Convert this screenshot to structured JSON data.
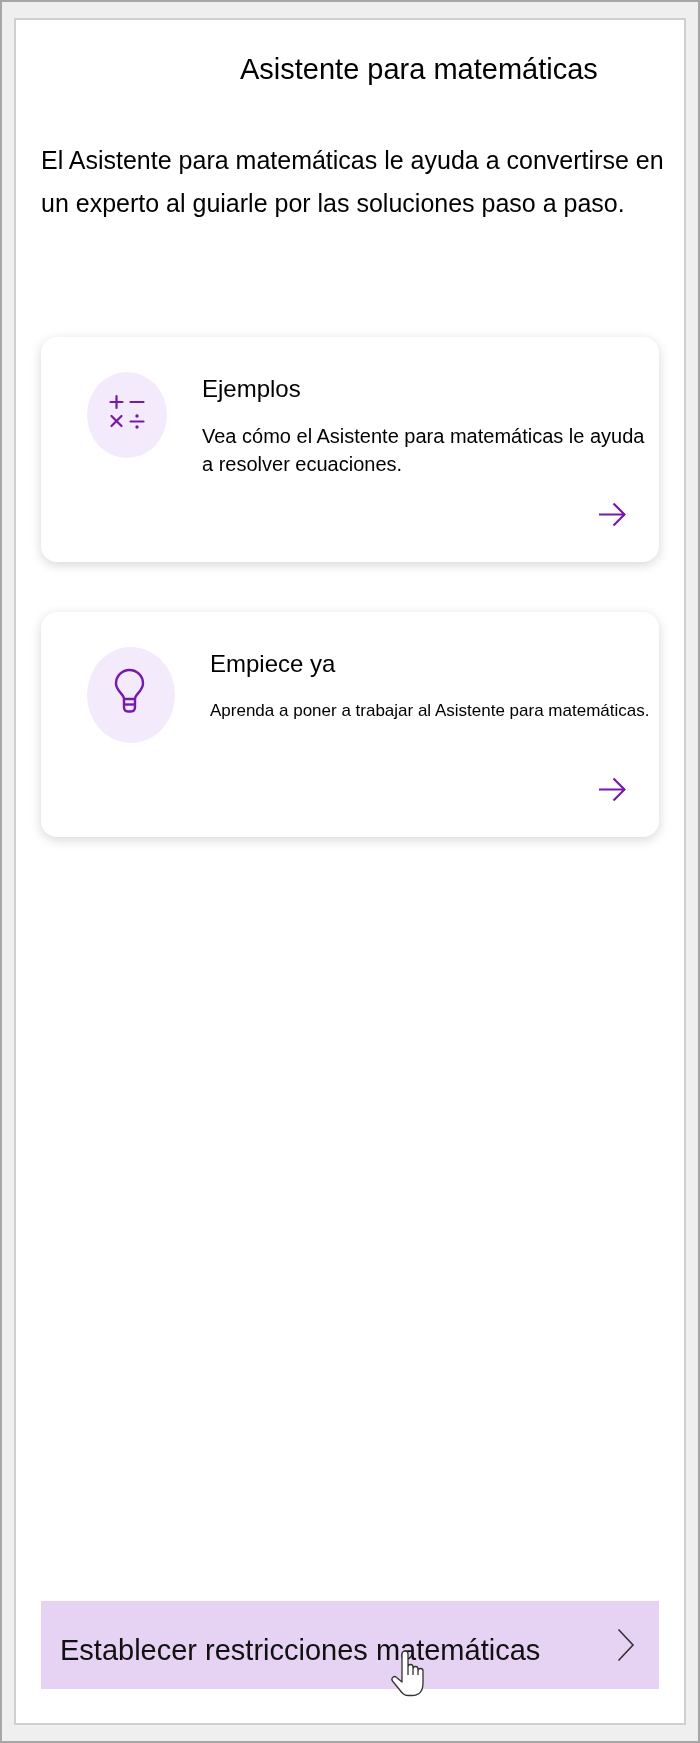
{
  "title": "Asistente para matemáticas",
  "intro": "El Asistente para matemáticas le ayuda a convertirse en un experto al guiarle por las soluciones paso a paso.",
  "cards": [
    {
      "kind": "examples",
      "title": "Ejemplos",
      "description": "Vea cómo el Asistente para matemáticas le ayuda a resolver ecuaciones."
    },
    {
      "kind": "get-started",
      "title": "Empiece ya",
      "description": "Aprenda a poner a trabajar al Asistente para matemáticas."
    }
  ],
  "constraints_button": {
    "label": "Establecer restricciones matemáticas"
  }
}
